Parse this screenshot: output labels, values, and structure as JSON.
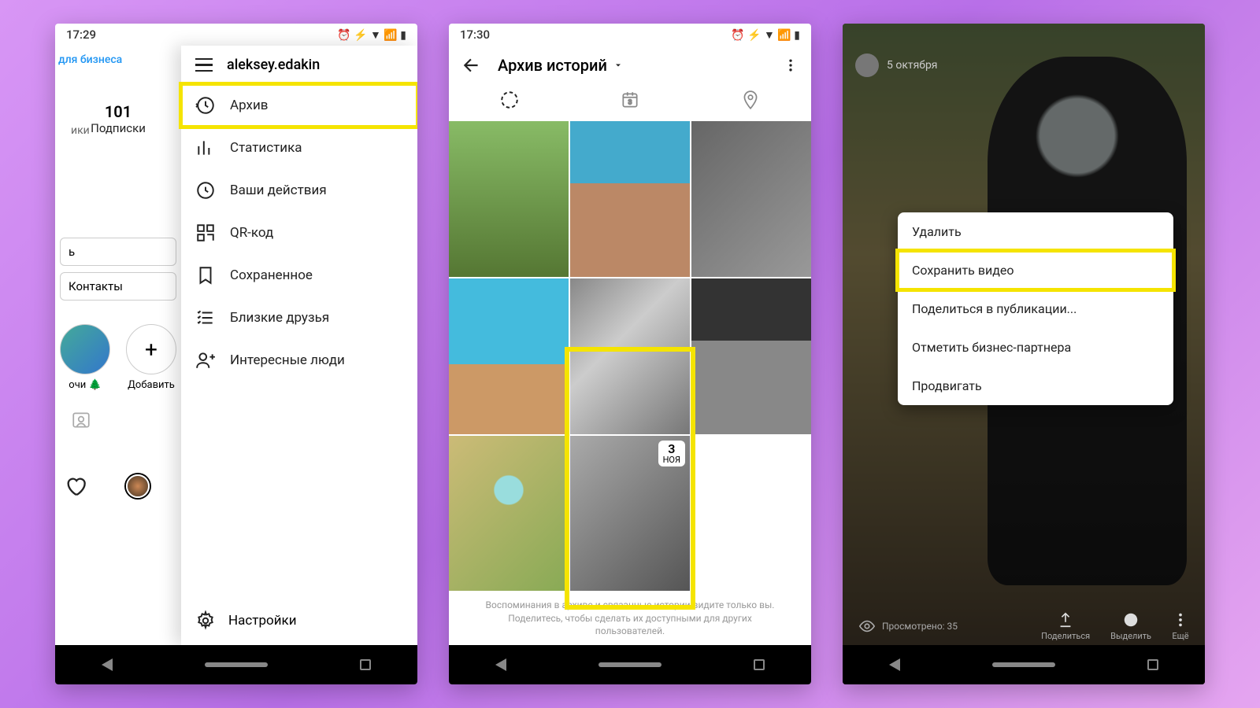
{
  "phone1": {
    "time": "17:29",
    "business_link": "для бизнеса",
    "posts_label_partial": "ики",
    "subs": {
      "count": "101",
      "label": "Подписки"
    },
    "edit_btn_partial": "ь",
    "contacts_btn": "Контакты",
    "highlight1_label": "очи 🌲",
    "highlight2_label": "Добавить",
    "username": "aleksey.edakin",
    "menu": {
      "archive": "Архив",
      "stats": "Статистика",
      "actions": "Ваши действия",
      "qr": "QR-код",
      "saved": "Сохраненное",
      "friends": "Близкие друзья",
      "people": "Интересные люди"
    },
    "settings": "Настройки"
  },
  "phone2": {
    "time": "17:30",
    "title": "Архив историй",
    "date_badge": {
      "day": "3",
      "month": "НОЯ"
    },
    "archive_footer": "Воспоминания в архиве и связанные истории видите только вы. Поделитесь, чтобы сделать их доступными для других пользователей."
  },
  "phone3": {
    "story_date": "5 октября",
    "menu": {
      "delete": "Удалить",
      "save": "Сохранить видео",
      "share_post": "Поделиться в публикации...",
      "tag": "Отметить бизнес-партнера",
      "promote": "Продвигать"
    },
    "views_label": "Просмотрено: 35",
    "share": "Поделиться",
    "highlight": "Выделить",
    "more": "Ещё"
  },
  "highlight_color": "#f5e400"
}
